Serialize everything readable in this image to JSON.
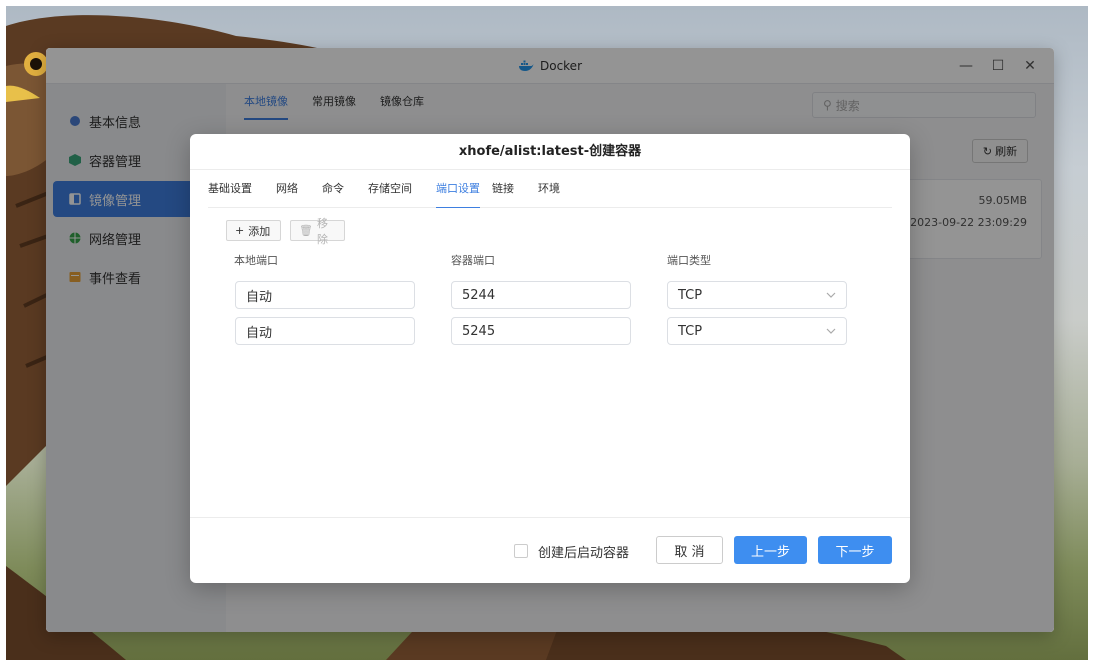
{
  "window": {
    "title": "Docker"
  },
  "sidebar": {
    "items": [
      {
        "label": "基本信息",
        "icon": "info-icon",
        "active": false
      },
      {
        "label": "容器管理",
        "icon": "container-icon",
        "active": false
      },
      {
        "label": "镜像管理",
        "icon": "image-icon",
        "active": true
      },
      {
        "label": "网络管理",
        "icon": "network-icon",
        "active": false
      },
      {
        "label": "事件查看",
        "icon": "event-icon",
        "active": false
      }
    ]
  },
  "main": {
    "tabs": [
      {
        "label": "本地镜像",
        "active": true
      },
      {
        "label": "常用镜像",
        "active": false
      },
      {
        "label": "镜像仓库",
        "active": false
      }
    ],
    "search_placeholder": "搜索",
    "refresh_label": "刷新",
    "image_card": {
      "size": "59.05MB",
      "created": "2023-09-22 23:09:29"
    }
  },
  "dialog": {
    "title": "xhofe/alist:latest-创建容器",
    "tabs": [
      {
        "label": "基础设置",
        "active": false
      },
      {
        "label": "网络",
        "active": false
      },
      {
        "label": "命令",
        "active": false
      },
      {
        "label": "存储空间",
        "active": false
      },
      {
        "label": "端口设置",
        "active": true
      },
      {
        "label": "链接",
        "active": false
      },
      {
        "label": "环境",
        "active": false
      }
    ],
    "add_label": "添加",
    "remove_label": "移除",
    "columns": {
      "local": "本地端口",
      "container": "容器端口",
      "type": "端口类型"
    },
    "rows": [
      {
        "local": "自动",
        "container": "5244",
        "type": "TCP"
      },
      {
        "local": "自动",
        "container": "5245",
        "type": "TCP"
      }
    ],
    "footer": {
      "checkbox_label": "创建后启动容器",
      "checkbox_checked": false,
      "cancel_label": "取 消",
      "prev_label": "上一步",
      "next_label": "下一步"
    }
  },
  "colors": {
    "accent": "#3e7fe0",
    "button_primary": "#3e8ef0"
  }
}
